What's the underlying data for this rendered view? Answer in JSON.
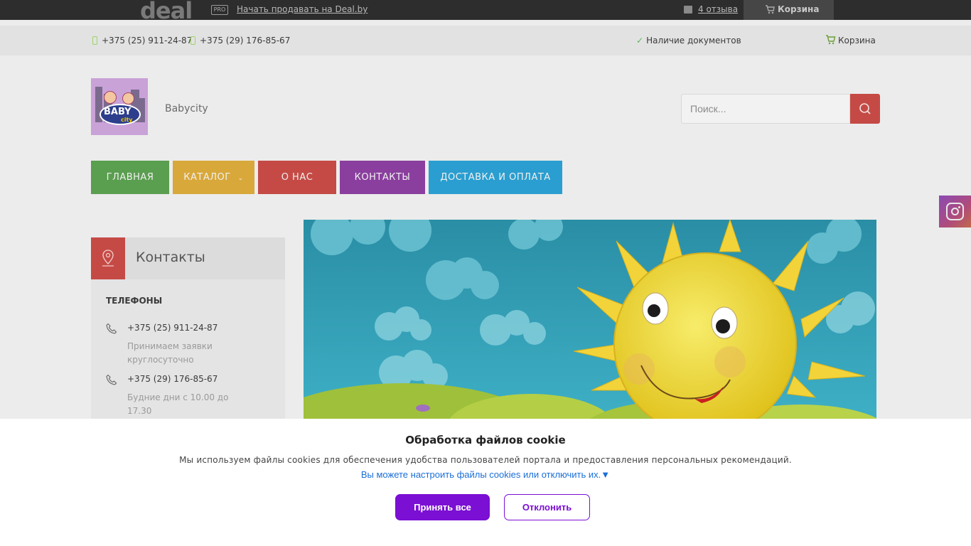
{
  "topbar": {
    "logo": "deal",
    "pro_badge": "PRO",
    "sell_link": "Начать продавать на Deal.by",
    "reviews": "4 отзыва",
    "cart": "Корзина"
  },
  "infobar": {
    "phone1": "+375 (25) 911-24-87",
    "phone2": "+375 (29) 176-85-67",
    "documents": "Наличие документов",
    "cart": "Корзина"
  },
  "header": {
    "logo_text": "BABY",
    "logo_subtext": "city",
    "shop_name": "Babycity",
    "search_placeholder": "Поиск..."
  },
  "nav": {
    "items": [
      {
        "label": "ГЛАВНАЯ",
        "color": "#5a9e4f"
      },
      {
        "label": "КАТАЛОГ",
        "color": "#d9a83a"
      },
      {
        "label": "О НАС",
        "color": "#c54a45"
      },
      {
        "label": "КОНТАКТЫ",
        "color": "#8a3f9e"
      },
      {
        "label": "ДОСТАВКА И ОПЛАТА",
        "color": "#2a9ed0"
      }
    ]
  },
  "contacts": {
    "title": "Контакты",
    "phones_heading": "ТЕЛЕФОНЫ",
    "phones": [
      {
        "number": "+375 (25) 911-24-87",
        "note": "Принимаем заявки круглосуточно"
      },
      {
        "number": "+375 (29) 176-85-67",
        "note": "Будние дни с 10.00 до 17.30"
      }
    ]
  },
  "cookie": {
    "title": "Обработка файлов cookie",
    "text": "Мы используем файлы cookies для обеспечения удобства пользователей портала и предоставления персональных рекомендаций.",
    "settings_link": "Вы можете настроить файлы cookies или отключить их.▼",
    "accept": "Принять все",
    "reject": "Отклонить"
  },
  "colors": {
    "accent_red": "#c54a45",
    "cookie_purple": "#7b0fd3",
    "link_blue": "#1a6ed8"
  }
}
